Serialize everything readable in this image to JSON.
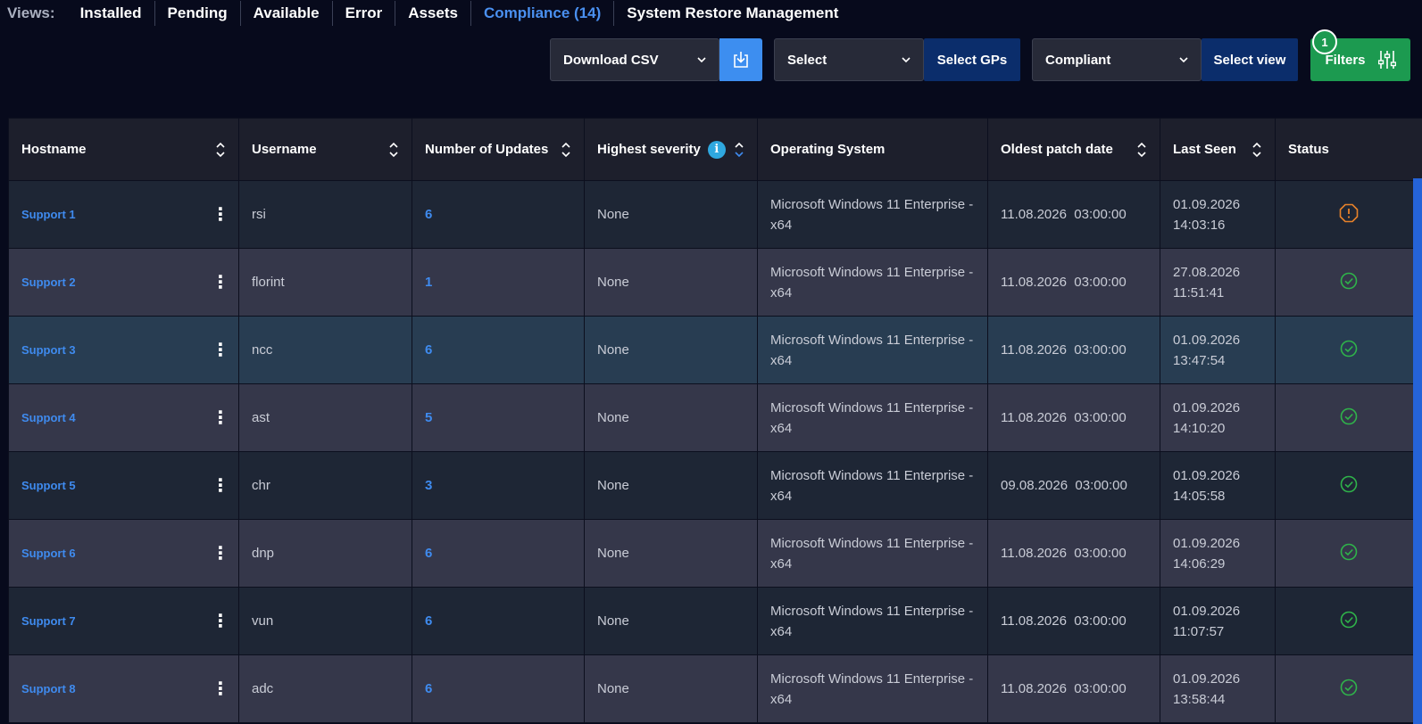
{
  "views": {
    "label": "Views:",
    "tabs": [
      {
        "label": "Installed",
        "active": false
      },
      {
        "label": "Pending",
        "active": false
      },
      {
        "label": "Available",
        "active": false
      },
      {
        "label": "Error",
        "active": false
      },
      {
        "label": "Assets",
        "active": false
      },
      {
        "label": "Compliance (14)",
        "active": true
      },
      {
        "label": "System Restore Management",
        "active": false
      }
    ]
  },
  "toolbar": {
    "download_select": "Download CSV",
    "gp_select": "Select",
    "select_gps_label": "Select GPs",
    "view_select": "Compliant",
    "select_view_label": "Select view",
    "filters_label": "Filters",
    "filters_badge": "1"
  },
  "table": {
    "headers": {
      "hostname": "Hostname",
      "username": "Username",
      "updates": "Number of Updates",
      "severity": "Highest severity",
      "os": "Operating System",
      "oldest": "Oldest patch date",
      "last_seen": "Last Seen",
      "status": "Status"
    },
    "rows": [
      {
        "hostname": "Support 1",
        "username": "rsi",
        "updates": "6",
        "severity": "None",
        "os_line1": "Microsoft Windows 11 Enterprise -",
        "os_line2": "x64",
        "oldest": "11.08.2026  03:00:00",
        "seen_date": "01.09.2026",
        "seen_time": "14:03:16",
        "status": "warning",
        "style": "dark"
      },
      {
        "hostname": "Support 2",
        "username": "florint",
        "updates": "1",
        "severity": "None",
        "os_line1": "Microsoft Windows 11 Enterprise -",
        "os_line2": "x64",
        "oldest": "11.08.2026  03:00:00",
        "seen_date": "27.08.2026",
        "seen_time": "11:51:41",
        "status": "ok",
        "style": "light"
      },
      {
        "hostname": "Support 3",
        "username": "ncc",
        "updates": "6",
        "severity": "None",
        "os_line1": "Microsoft Windows 11 Enterprise -",
        "os_line2": "x64",
        "oldest": "11.08.2026  03:00:00",
        "seen_date": "01.09.2026",
        "seen_time": "13:47:54",
        "status": "ok",
        "style": "highlight"
      },
      {
        "hostname": "Support 4",
        "username": "ast",
        "updates": "5",
        "severity": "None",
        "os_line1": "Microsoft Windows 11 Enterprise -",
        "os_line2": "x64",
        "oldest": "11.08.2026  03:00:00",
        "seen_date": "01.09.2026",
        "seen_time": "14:10:20",
        "status": "ok",
        "style": "light"
      },
      {
        "hostname": "Support 5",
        "username": "chr",
        "updates": "3",
        "severity": "None",
        "os_line1": "Microsoft Windows 11 Enterprise -",
        "os_line2": "x64",
        "oldest": "09.08.2026  03:00:00",
        "seen_date": "01.09.2026",
        "seen_time": "14:05:58",
        "status": "ok",
        "style": "dark"
      },
      {
        "hostname": "Support 6",
        "username": "dnp",
        "updates": "6",
        "severity": "None",
        "os_line1": "Microsoft Windows 11 Enterprise -",
        "os_line2": "x64",
        "oldest": "11.08.2026  03:00:00",
        "seen_date": "01.09.2026",
        "seen_time": "14:06:29",
        "status": "ok",
        "style": "light"
      },
      {
        "hostname": "Support 7",
        "username": "vun",
        "updates": "6",
        "severity": "None",
        "os_line1": "Microsoft Windows 11 Enterprise -",
        "os_line2": "x64",
        "oldest": "11.08.2026  03:00:00",
        "seen_date": "01.09.2026",
        "seen_time": "11:07:57",
        "status": "ok",
        "style": "dark"
      },
      {
        "hostname": "Support 8",
        "username": "adc",
        "updates": "6",
        "severity": "None",
        "os_line1": "Microsoft Windows 11 Enterprise -",
        "os_line2": "x64",
        "oldest": "11.08.2026  03:00:00",
        "seen_date": "01.09.2026",
        "seen_time": "13:58:44",
        "status": "ok",
        "style": "light"
      }
    ]
  },
  "colors": {
    "accent": "#3f8bef",
    "ok": "#2fb34a",
    "warning": "#e8822a",
    "filters": "#1c9a50"
  }
}
